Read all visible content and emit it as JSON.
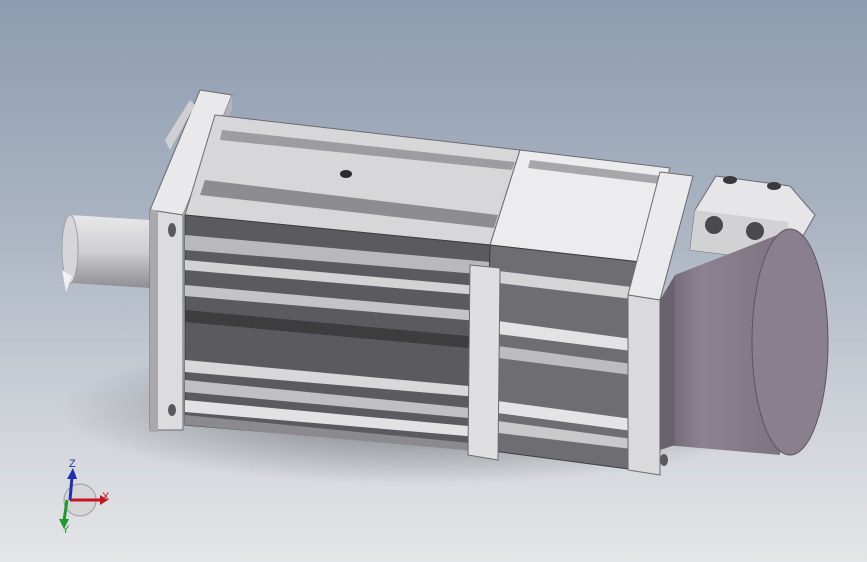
{
  "viewport": {
    "background_top": "#8d9cb0",
    "background_bottom": "#e4e5e7"
  },
  "model": {
    "part": "servo-motor",
    "surface_color": "#d9d9dc",
    "shadow_color": "#3a3a3c",
    "encoder_cap_color": "#8a7f8c"
  },
  "triad": {
    "x_label": "X",
    "y_label": "Y",
    "z_label": "Z",
    "x_color": "#c8141e",
    "y_color": "#1e9b2a",
    "z_color": "#1e2fb4"
  }
}
